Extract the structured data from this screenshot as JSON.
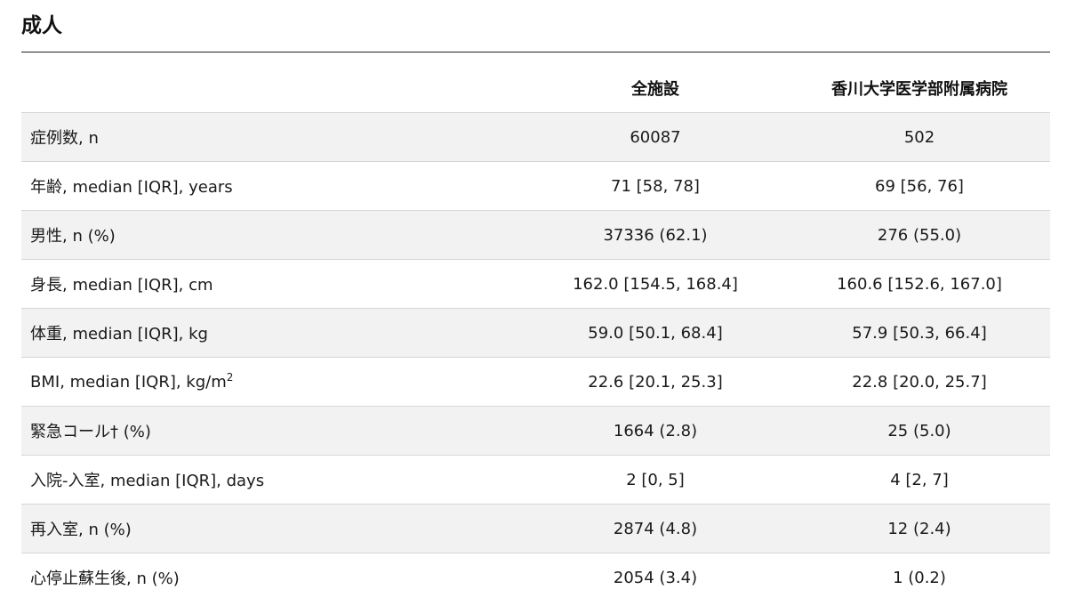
{
  "section": {
    "title": "成人"
  },
  "table": {
    "headers": [
      "",
      "全施設",
      "香川大学医学部附属病院"
    ],
    "rows": [
      {
        "label": "症例数, n",
        "all": "60087",
        "site": "502"
      },
      {
        "label": "年齢, median [IQR], years",
        "all": "71 [58, 78]",
        "site": "69 [56, 76]"
      },
      {
        "label": "男性, n (%)",
        "all": "37336 (62.1)",
        "site": "276 (55.0)"
      },
      {
        "label": "身長, median [IQR], cm",
        "all": "162.0 [154.5, 168.4]",
        "site": "160.6 [152.6, 167.0]"
      },
      {
        "label": "体重, median [IQR], kg",
        "all": "59.0 [50.1, 68.4]",
        "site": "57.9 [50.3, 66.4]"
      },
      {
        "label": "BMI, median [IQR], kg/m",
        "label_sup": "2",
        "all": "22.6 [20.1, 25.3]",
        "site": "22.8 [20.0, 25.7]"
      },
      {
        "label": "緊急コール† (%)",
        "all": "1664 (2.8)",
        "site": "25 (5.0)"
      },
      {
        "label": "入院-入室, median [IQR], days",
        "all": "2 [0, 5]",
        "site": "4 [2, 7]"
      },
      {
        "label": "再入室, n (%)",
        "all": "2874 (4.8)",
        "site": "12 (2.4)"
      },
      {
        "label": "心停止蘇生後, n (%)",
        "all": "2054 (3.4)",
        "site": "1 (0.2)"
      }
    ]
  }
}
